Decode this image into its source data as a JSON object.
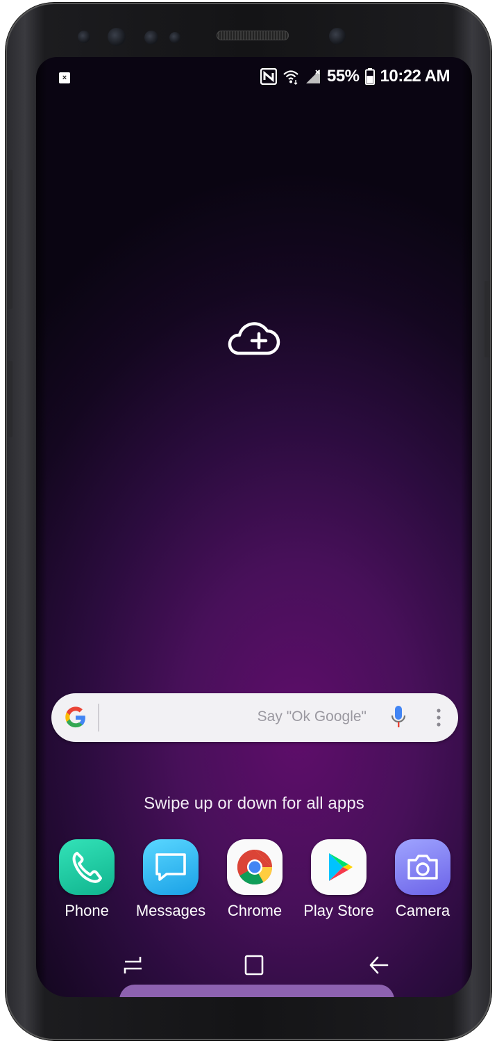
{
  "status_bar": {
    "notification_icon": "close-notification-icon",
    "icons": [
      "nfc-icon",
      "wifi-icon",
      "signal-icon",
      "battery-icon"
    ],
    "battery": "55%",
    "time": "10:22 AM"
  },
  "wallpaper": {
    "center_icon": "cloud-add-icon"
  },
  "search": {
    "placeholder": "Say \"Ok Google\"",
    "logo": "google-g-icon",
    "mic": "mic-icon",
    "menu": "more-vert-icon"
  },
  "hint": "Swipe up or down for all apps",
  "dock": {
    "apps": [
      {
        "label": "Phone",
        "icon": "phone-icon",
        "color": "#1fcaa0"
      },
      {
        "label": "Messages",
        "icon": "messages-icon",
        "color": "#36b8f2"
      },
      {
        "label": "Chrome",
        "icon": "chrome-icon",
        "color": "#fafafa"
      },
      {
        "label": "Play Store",
        "icon": "play-store-icon",
        "color": "#fafafa"
      },
      {
        "label": "Camera",
        "icon": "camera-icon",
        "color": "#8580f4"
      }
    ]
  },
  "nav": {
    "buttons": [
      "recents-icon",
      "home-icon",
      "back-icon"
    ]
  },
  "colors": {
    "wallpaper_accent": "#5e0d6a",
    "search_bg": "#f2f1f4",
    "sheet": "#8d62b0"
  }
}
